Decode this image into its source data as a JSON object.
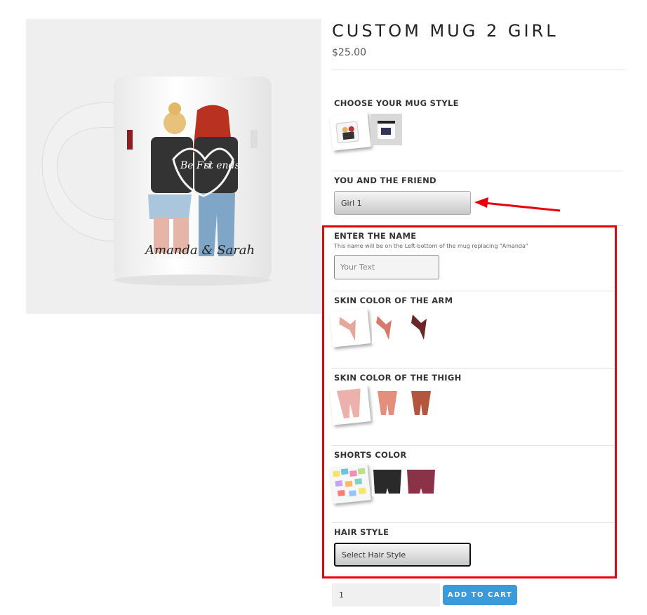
{
  "product": {
    "title": "CUSTOM MUG 2 GIRL",
    "price": "$25.00",
    "mug_text": "Amanda & Sarah",
    "jacket_left": "Be Fri",
    "jacket_right": "st ends"
  },
  "options": {
    "mug_style": {
      "label": "CHOOSE YOUR MUG STYLE"
    },
    "friend": {
      "label": "YOU AND THE FRIEND",
      "selected": "Girl 1"
    },
    "name": {
      "label": "ENTER THE NAME",
      "help": "This name will be on the Left-bottom of the mug replacing \"Amanda\"",
      "placeholder": "Your Text"
    },
    "arm": {
      "label": "SKIN COLOR OF THE ARM"
    },
    "thigh": {
      "label": "SKIN COLOR OF THE THIGH"
    },
    "shorts": {
      "label": "SHORTS COLOR"
    },
    "hair": {
      "label": "HAIR STYLE",
      "selected": "Select Hair Style"
    }
  },
  "cart": {
    "quantity": "1",
    "button": "ADD TO CART"
  },
  "colors": {
    "accent": "#3b9ad9",
    "highlight": "#e8000b"
  }
}
